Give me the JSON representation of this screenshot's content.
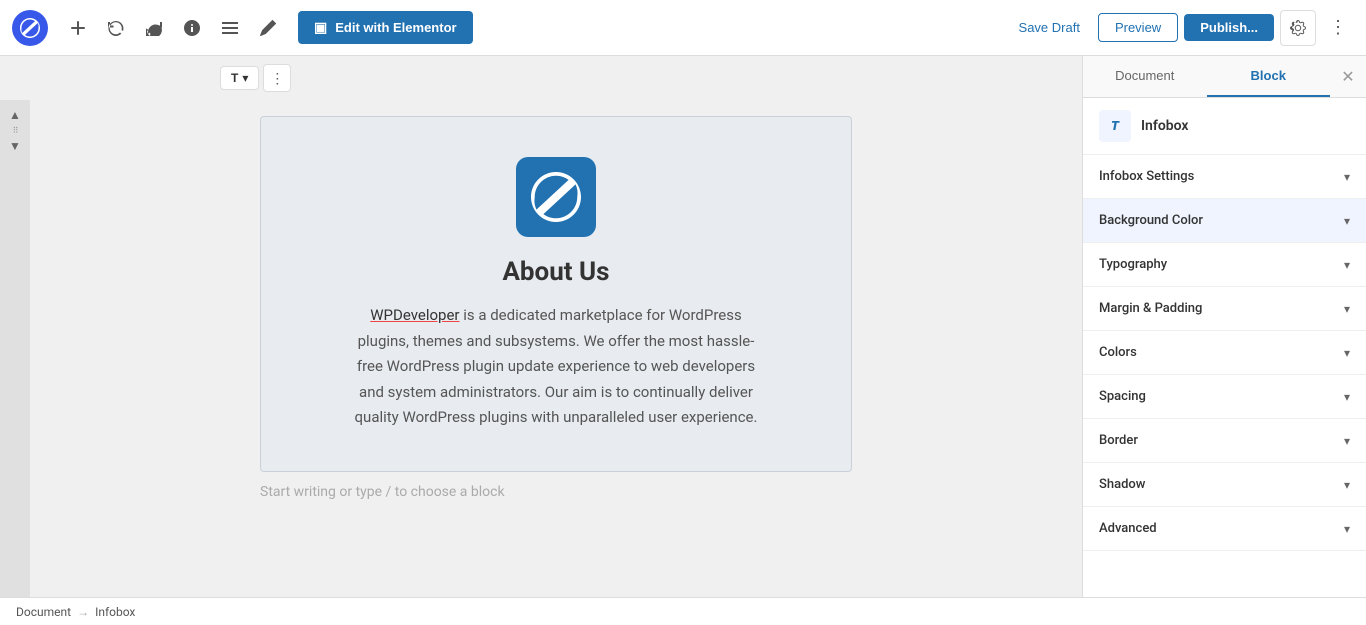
{
  "toolbar": {
    "edit_elementor_label": "Edit with Elementor",
    "save_draft_label": "Save Draft",
    "preview_label": "Preview",
    "publish_label": "Publish...",
    "undo_icon": "↩",
    "redo_icon": "↪",
    "info_icon": "ℹ",
    "list_icon": "≡",
    "edit_icon": "✏"
  },
  "panel": {
    "document_tab": "Document",
    "block_tab": "Block",
    "active_tab": "Block",
    "block_name": "Infobox",
    "close_icon": "✕",
    "accordion_items": [
      {
        "label": "Infobox Settings",
        "id": "infobox-settings"
      },
      {
        "label": "Background Color",
        "id": "background-color",
        "highlighted": true
      },
      {
        "label": "Typography",
        "id": "typography"
      },
      {
        "label": "Margin & Padding",
        "id": "margin-padding"
      },
      {
        "label": "Colors",
        "id": "colors"
      },
      {
        "label": "Spacing",
        "id": "spacing"
      },
      {
        "label": "Border",
        "id": "border"
      },
      {
        "label": "Shadow",
        "id": "shadow"
      },
      {
        "label": "Advanced",
        "id": "advanced"
      }
    ]
  },
  "editor": {
    "block_type": "T",
    "about_title": "About Us",
    "about_text_link": "WPDeveloper",
    "about_text_body": " is a dedicated marketplace for WordPress plugins, themes and subsystems. We offer the most hassle-free WordPress plugin update experience to web developers and system administrators. Our aim is to continually deliver quality WordPress plugins with unparalleled user experience.",
    "start_writing_hint": "Start writing or type / to choose a block"
  },
  "breadcrumb": {
    "items": [
      "Document",
      "Infobox"
    ],
    "arrow": "→"
  }
}
